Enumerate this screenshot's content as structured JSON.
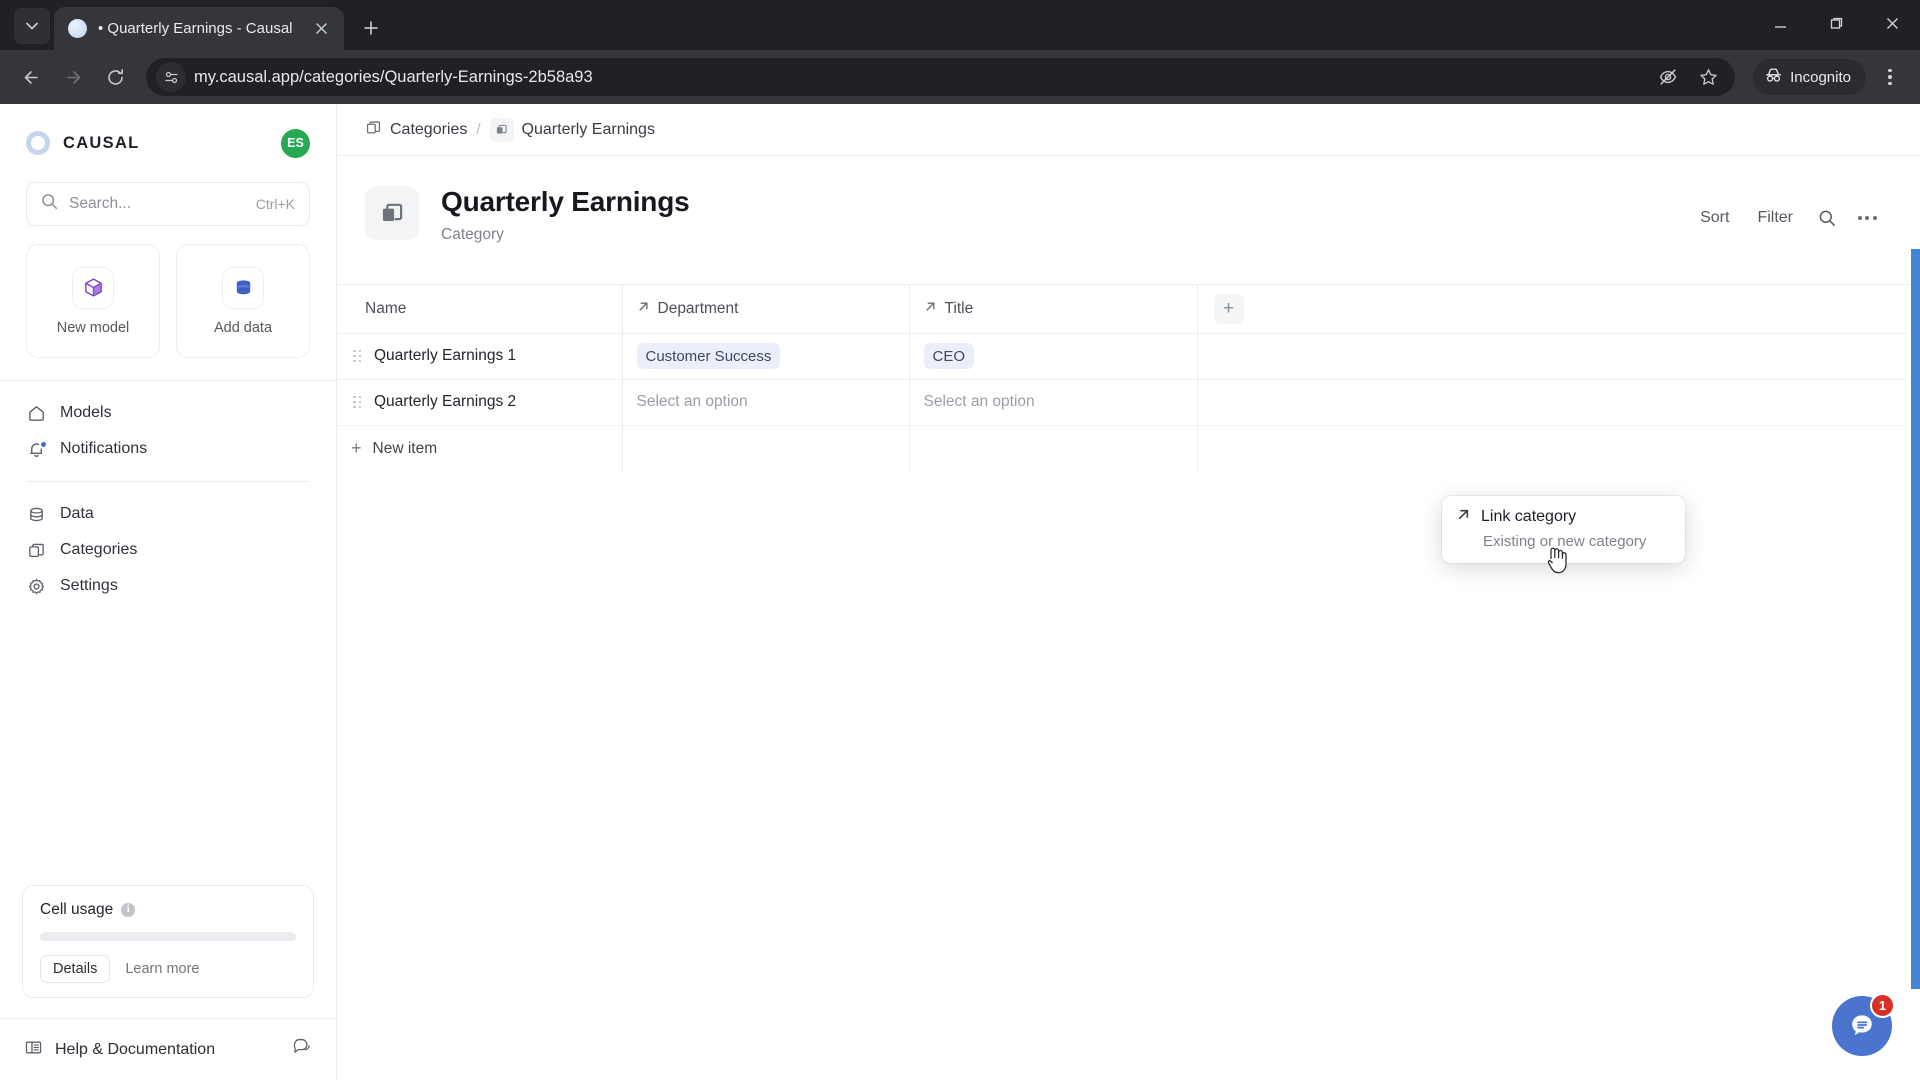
{
  "browser": {
    "tab": {
      "title": "• Quarterly Earnings - Causal",
      "close_label": "✕",
      "favicon": "causal-favicon"
    },
    "new_tab_label": "+",
    "tab_list_label": "⌄",
    "window": {
      "minimize": "minimize",
      "maximize": "maximize",
      "close": "close"
    },
    "nav": {
      "back": "back-arrow",
      "forward": "forward-arrow",
      "reload": "reload-arrow"
    },
    "omnibox": {
      "url": "my.causal.app/categories/Quarterly-Earnings-2b58a93",
      "site_info": "site-settings-icon"
    },
    "actions": {
      "hide_label": "hide-password-icon",
      "bookmark_label": "bookmark-star-icon",
      "incognito_label": "Incognito",
      "menu_label": "browser-menu"
    }
  },
  "sidebar": {
    "brand": "CAUSAL",
    "avatar_initials": "ES",
    "search": {
      "placeholder": "Search...",
      "shortcut": "Ctrl+K"
    },
    "quick_actions": [
      {
        "label": "New model",
        "icon": "cube-icon"
      },
      {
        "label": "Add data",
        "icon": "database-icon"
      }
    ],
    "nav_primary": [
      {
        "label": "Models",
        "icon": "home-icon",
        "badge": false
      },
      {
        "label": "Notifications",
        "icon": "bell-icon",
        "badge": true
      }
    ],
    "nav_secondary": [
      {
        "label": "Data",
        "icon": "database-icon"
      },
      {
        "label": "Categories",
        "icon": "layers-icon"
      },
      {
        "label": "Settings",
        "icon": "gear-icon"
      }
    ],
    "usage": {
      "title": "Cell usage",
      "info": "i",
      "progress_percent": 0,
      "details_label": "Details",
      "learn_more_label": "Learn more"
    },
    "footer": {
      "label": "Help & Documentation",
      "icon": "book-icon",
      "chat_icon": "chat-icon"
    }
  },
  "breadcrumb": {
    "root": "Categories",
    "separator": "/",
    "current": "Quarterly Earnings"
  },
  "page": {
    "title": "Quarterly Earnings",
    "subtitle": "Category",
    "icon": "layers-icon",
    "actions": {
      "sort": "Sort",
      "filter": "Filter",
      "search": "search-icon",
      "more": "more-options-icon"
    }
  },
  "table": {
    "columns": [
      {
        "label": "Name",
        "icon": null
      },
      {
        "label": "Department",
        "icon": "link-arrow-icon"
      },
      {
        "label": "Title",
        "icon": "link-arrow-icon"
      }
    ],
    "add_column_label": "+",
    "rows": [
      {
        "name": "Quarterly Earnings 1",
        "department": "Customer Success",
        "department_type": "chip",
        "title": "CEO",
        "title_type": "chip"
      },
      {
        "name": "Quarterly Earnings 2",
        "department": "Select an option",
        "department_type": "placeholder",
        "title": "Select an option",
        "title_type": "placeholder"
      }
    ],
    "new_item_label": "New item",
    "new_item_icon": "+"
  },
  "popup": {
    "icon": "link-arrow-icon",
    "title": "Link category",
    "subtitle": "Existing or new category"
  },
  "chat": {
    "badge_count": "1",
    "icon": "chat-bubble-icon"
  },
  "colors": {
    "accent_blue": "#4384d4",
    "chip_bg": "#eceffb",
    "chip_text": "#3e4766",
    "avatar_green": "#27a852",
    "badge_red": "#d93025",
    "chat_blue": "#4a74cd"
  }
}
